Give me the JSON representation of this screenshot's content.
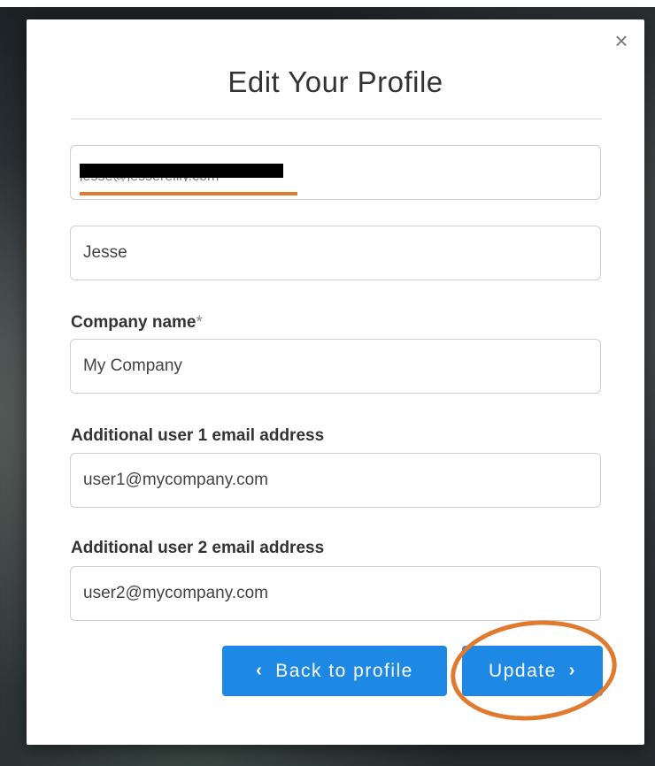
{
  "modal": {
    "title": "Edit Your Profile",
    "close_glyph": "×"
  },
  "form": {
    "email": {
      "value": "jesse@jessereilly.com"
    },
    "first_name": {
      "value": "Jesse"
    },
    "company": {
      "label": "Company name",
      "required_mark": "*",
      "value": "My Company"
    },
    "additional_user_1": {
      "label": "Additional user 1 email address",
      "value": "user1@mycompany.com"
    },
    "additional_user_2": {
      "label": "Additional user 2 email address",
      "value": "user2@mycompany.com"
    }
  },
  "buttons": {
    "back": {
      "label": "Back to profile",
      "icon": "chevron-left-icon",
      "glyph": "‹"
    },
    "update": {
      "label": "Update",
      "icon": "chevron-right-icon",
      "glyph": "›"
    }
  },
  "colors": {
    "primary": "#1e88e5",
    "annotation": "#e07a2e"
  }
}
